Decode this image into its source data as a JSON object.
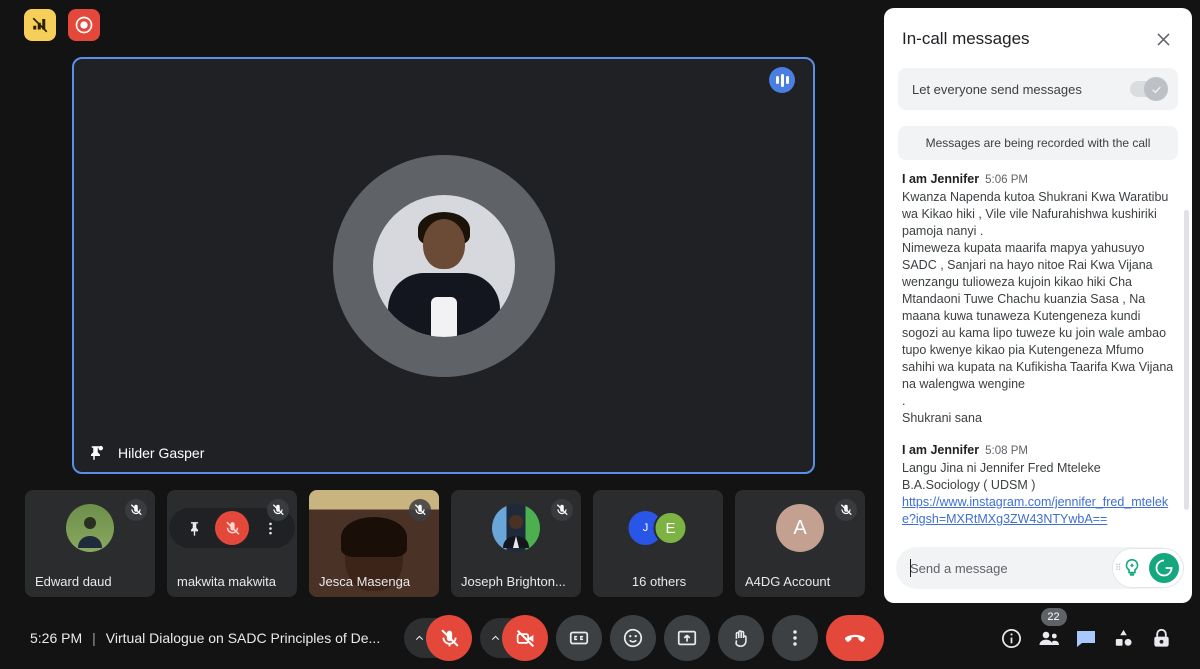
{
  "top_badges": [
    {
      "name": "network-off-badge",
      "color": "#f5cf5a"
    },
    {
      "name": "recording-badge",
      "color": "#e4483a"
    }
  ],
  "stage": {
    "speaker_name": "Hilder Gasper",
    "pin_icon": "pin-icon",
    "audio_indicator": "audio-level-icon",
    "border_color": "#5b8ee6"
  },
  "thumbnails": [
    {
      "label": "Edward daud",
      "type": "avatar",
      "muted": true,
      "hovered": false
    },
    {
      "label": "makwita makwita",
      "type": "avatar",
      "muted": true,
      "hovered": true,
      "hover_actions": [
        "pin-icon",
        "mute-icon",
        "more-options-icon"
      ]
    },
    {
      "label": "Jesca Masenga",
      "type": "video",
      "muted": true,
      "hovered": false
    },
    {
      "label": "Joseph Brighton...",
      "type": "avatar",
      "muted": true,
      "hovered": false
    },
    {
      "label": "16 others",
      "type": "group",
      "muted": false,
      "hovered": false,
      "group_avatars": [
        {
          "initial": "J",
          "color": "#2a56e8"
        },
        {
          "initial": "E",
          "color": "#7cb342"
        }
      ]
    },
    {
      "label": "A4DG Account",
      "type": "initial",
      "initial": "A",
      "initial_color": "#c3a08f",
      "muted": true,
      "hovered": false
    }
  ],
  "bottom_bar": {
    "time": "5:26 PM",
    "separator": "|",
    "meeting_title": "Virtual Dialogue on SADC Principles of De...",
    "controls": [
      {
        "name": "microphone-button",
        "icon": "mic-off-icon",
        "state": "off",
        "color": "#e4483a",
        "has_chevron": true
      },
      {
        "name": "camera-button",
        "icon": "camera-off-icon",
        "state": "off",
        "color": "#e4483a",
        "has_chevron": true
      },
      {
        "name": "captions-button",
        "icon": "captions-icon",
        "state": "default",
        "color": "#3c4043",
        "has_chevron": false
      },
      {
        "name": "emoji-button",
        "icon": "emoji-icon",
        "state": "default",
        "color": "#3c4043",
        "has_chevron": false
      },
      {
        "name": "present-button",
        "icon": "present-screen-icon",
        "state": "default",
        "color": "#3c4043",
        "has_chevron": false
      },
      {
        "name": "raise-hand-button",
        "icon": "raise-hand-icon",
        "state": "default",
        "color": "#3c4043",
        "has_chevron": false
      },
      {
        "name": "more-options-button",
        "icon": "more-vertical-icon",
        "state": "default",
        "color": "#3c4043",
        "has_chevron": false
      },
      {
        "name": "end-call-button",
        "icon": "end-call-icon",
        "state": "default",
        "color": "#e4483a",
        "has_chevron": false
      }
    ],
    "right_controls": [
      {
        "name": "meeting-details-button",
        "icon": "info-icon",
        "badge": null,
        "active": false
      },
      {
        "name": "people-button",
        "icon": "people-icon",
        "badge": "22",
        "active": false
      },
      {
        "name": "chat-button",
        "icon": "chat-icon",
        "badge": null,
        "active": true
      },
      {
        "name": "activities-button",
        "icon": "activities-icon",
        "badge": null,
        "active": false
      },
      {
        "name": "host-controls-button",
        "icon": "lock-shield-icon",
        "badge": null,
        "active": false
      }
    ]
  },
  "chat_panel": {
    "title": "In-call messages",
    "close_icon": "close-icon",
    "toggle_label": "Let everyone send messages",
    "toggle_state": "on-disabled",
    "recording_note": "Messages are being recorded with the call",
    "messages": [
      {
        "author": "I am Jennifer",
        "time": "5:06 PM",
        "body": "Kwanza Napenda kutoa Shukrani Kwa Waratibu wa Kikao hiki , Vile vile Nafurahishwa kushiriki pamoja nanyi .\nNimeweza kupata maarifa mapya yahusuyo SADC , Sanjari na hayo nitoe Rai Kwa Vijana wenzangu tulioweza kujoin kikao hiki Cha Mtandaoni Tuwe Chachu kuanzia Sasa , Na maana kuwa tunaweza Kutengeneza kundi sogozi au kama lipo tuweze ku join wale ambao tupo kwenye kikao pia Kutengeneza Mfumo sahihi wa kupata na Kufikisha Taarifa Kwa Vijana na walengwa wengine\n.\nShukrani sana",
        "link": null
      },
      {
        "author": "I am Jennifer",
        "time": "5:08 PM",
        "body": "Langu Jina ni Jennifer Fred Mteleke\nB.A.Sociology ( UDSM )",
        "link": "https://www.instagram.com/jennifer_fred_mteleke?igsh=MXRtMXg3ZW43NTYwbA=="
      }
    ],
    "composer_placeholder": "Send a message",
    "composer_addons": [
      "grammarly-suggestion-icon",
      "grammarly-logo-icon"
    ]
  }
}
